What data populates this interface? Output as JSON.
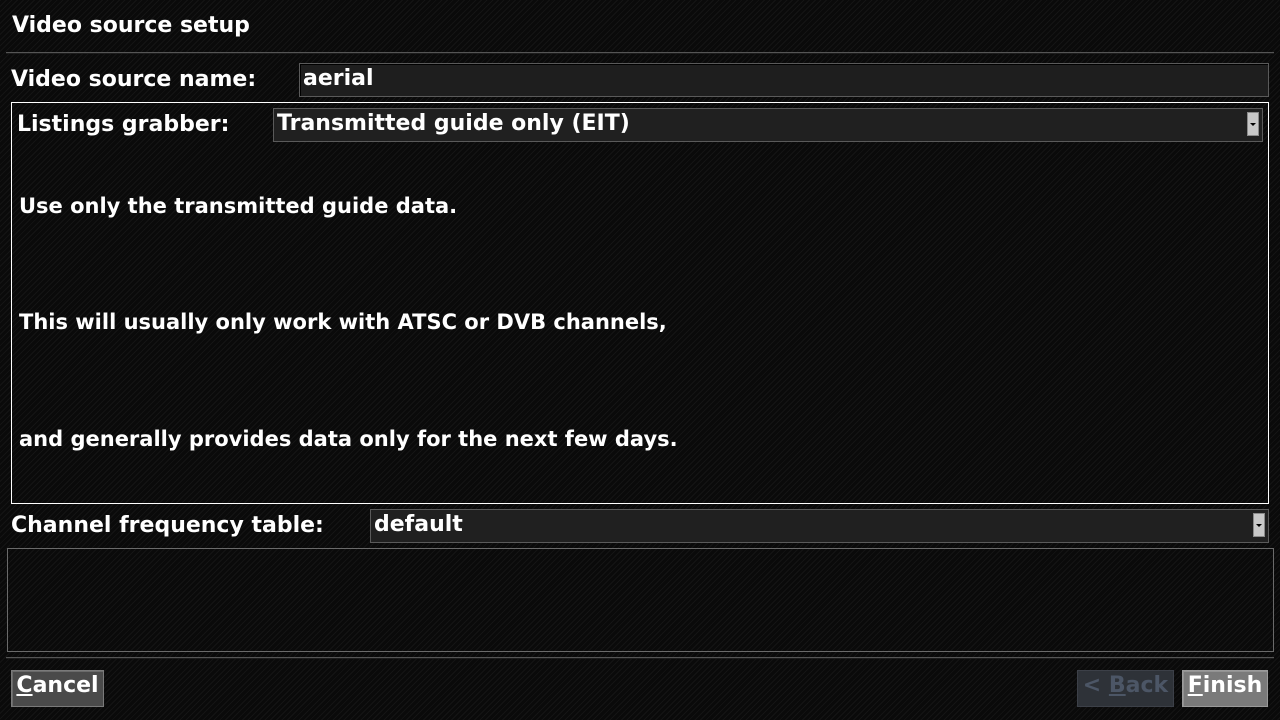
{
  "window": {
    "title": "Video source setup"
  },
  "source_name": {
    "label": "Video source name:",
    "value": "aerial"
  },
  "listings": {
    "label": "Listings grabber:",
    "selected": "Transmitted guide only (EIT)",
    "description": [
      "Use only the transmitted guide data.",
      "This will usually only work with ATSC or DVB channels,",
      "and generally provides data only for the next few days."
    ]
  },
  "frequency_table": {
    "label": "Channel frequency table:",
    "selected": "default"
  },
  "buttons": {
    "cancel": {
      "mnemonic": "C",
      "rest": "ancel",
      "enabled": true
    },
    "back": {
      "prefix": "< ",
      "mnemonic": "B",
      "rest": "ack",
      "enabled": false
    },
    "finish": {
      "mnemonic": "F",
      "rest": "inish",
      "enabled": true
    }
  },
  "icons": {
    "combo_arrow": "chevron-down-icon"
  },
  "colors": {
    "background": "#0a0a0a",
    "text": "#ffffff",
    "field_bg": "#1e1e1e",
    "button_bg": "#4a4a4a",
    "finish_bg": "#7a7a7a",
    "disabled_text": "#4c5666"
  }
}
